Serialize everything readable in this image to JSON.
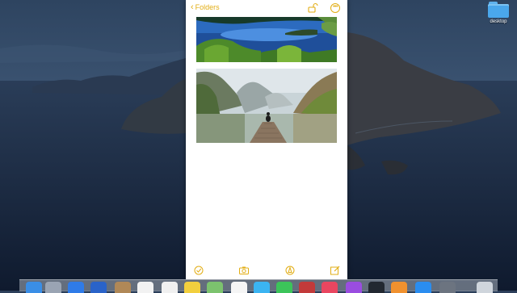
{
  "desktop": {
    "folder_label": "desktop",
    "folder_icon": "folder-icon"
  },
  "notes": {
    "back_label": "Folders",
    "back_icon": "chevron-left-icon",
    "toolbar_icons": [
      "share-lock-icon",
      "more-options-icon"
    ],
    "images": [
      {
        "name": "lake-with-island-photo"
      },
      {
        "name": "mountain-lake-dock-photo"
      }
    ],
    "bottom_toolbar_icons": [
      "checklist-icon",
      "camera-icon",
      "markup-pen-icon",
      "compose-icon"
    ],
    "accent_color": "#e2ad13"
  },
  "dock": {
    "apps": [
      {
        "name": "finder-icon",
        "color": "#3a8ee6"
      },
      {
        "name": "launchpad-icon",
        "color": "#9aa4b3"
      },
      {
        "name": "safari-icon",
        "color": "#2f7be8"
      },
      {
        "name": "mail-icon",
        "color": "#2a63c9"
      },
      {
        "name": "contacts-icon",
        "color": "#b08857"
      },
      {
        "name": "calendar-icon",
        "color": "#f2f2f2"
      },
      {
        "name": "reminders-icon",
        "color": "#f0f0f0"
      },
      {
        "name": "notes-icon",
        "color": "#f2cf3e"
      },
      {
        "name": "maps-icon",
        "color": "#7cc36e"
      },
      {
        "name": "photos-icon",
        "color": "#f5f5f5"
      },
      {
        "name": "messages-icon",
        "color": "#3bb4f2"
      },
      {
        "name": "facetime-icon",
        "color": "#3cc45a"
      },
      {
        "name": "photo-booth-icon",
        "color": "#c23a3a"
      },
      {
        "name": "music-icon",
        "color": "#e94660"
      },
      {
        "name": "podcasts-icon",
        "color": "#9a4de0"
      },
      {
        "name": "tv-icon",
        "color": "#222831"
      },
      {
        "name": "books-icon",
        "color": "#f0912f"
      },
      {
        "name": "app-store-icon",
        "color": "#2a8df0"
      },
      {
        "name": "system-preferences-icon",
        "color": "#6c7480"
      },
      {
        "name": "trash-icon",
        "color": "#cfd5dc"
      }
    ]
  }
}
